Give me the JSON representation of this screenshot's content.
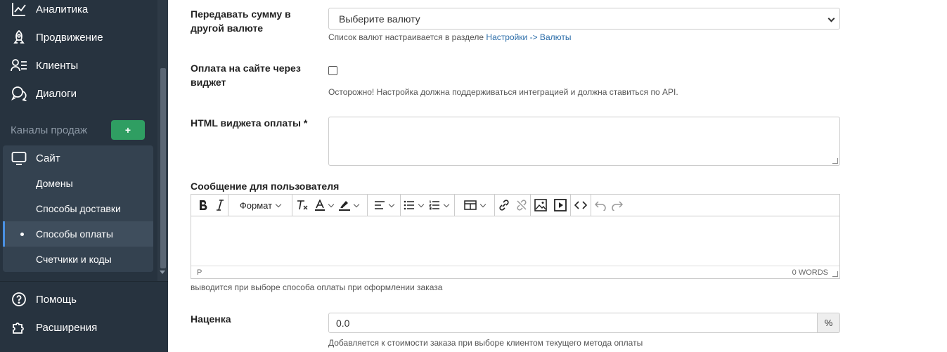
{
  "sidebar": {
    "items": [
      {
        "label": "Аналитика",
        "icon": "chart-line-icon"
      },
      {
        "label": "Продвижение",
        "icon": "rocket-icon"
      },
      {
        "label": "Клиенты",
        "icon": "users-list-icon"
      },
      {
        "label": "Диалоги",
        "icon": "chat-bubbles-icon"
      }
    ],
    "sales_channels_label": "Каналы продаж",
    "add_button_label": "+",
    "site": {
      "label": "Сайт",
      "icon": "monitor-icon"
    },
    "sub_items": [
      {
        "label": "Домены"
      },
      {
        "label": "Способы доставки"
      },
      {
        "label": "Способы оплаты",
        "active": true
      },
      {
        "label": "Счетчики и коды"
      }
    ],
    "bottom_items": [
      {
        "label": "Помощь",
        "icon": "help-circle-icon"
      },
      {
        "label": "Расширения",
        "icon": "puzzle-icon"
      }
    ]
  },
  "form": {
    "currency": {
      "label": "Передавать сумму в другой валюте",
      "select_value": "Выберите валюту",
      "help_prefix": "Список валют настраивается в разделе ",
      "help_link": "Настройки -> Валюты"
    },
    "widget_payment": {
      "label": "Оплата на сайте через виджет",
      "checked": false,
      "help": "Осторожно! Настройка должна поддерживаться интеграцией и должна ставиться по API."
    },
    "widget_html": {
      "label": "HTML виджета оплаты *",
      "value": ""
    },
    "user_message": {
      "label": "Сообщение для пользователя",
      "format_label": "Формат",
      "status_path": "P",
      "word_count": "0 WORDS",
      "help": "выводится при выборе способа оплаты при оформлении заказа"
    },
    "markup": {
      "label": "Наценка",
      "value": "0.0",
      "addon": "%",
      "help": "Добавляется к стоимости заказа при выборе клиентом текущего метода оплаты"
    }
  },
  "colors": {
    "sidebar_bg": "#27333f",
    "add_button": "#2f9e62",
    "active_indicator": "#4a90e2",
    "link": "#2a6ca8"
  }
}
